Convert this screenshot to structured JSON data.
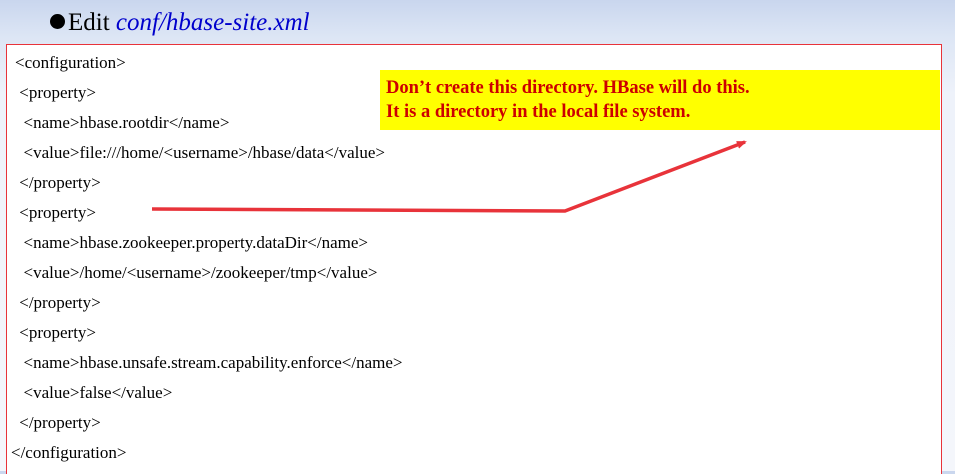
{
  "heading": {
    "prefix": "Edit ",
    "filename": "conf/hbase-site.xml"
  },
  "code_lines": [
    "<configuration>",
    " <property>",
    "  <name>hbase.rootdir</name>",
    "  <value>file:///home/<username>/hbase/data</value>",
    " </property>",
    " <property>",
    "  <name>hbase.zookeeper.property.dataDir</name>",
    "  <value>/home/<username>/zookeeper/tmp</value>",
    " </property>",
    " <property>",
    "  <name>hbase.unsafe.stream.capability.enforce</name>",
    "  <value>false</value>",
    " </property>",
    "</configuration>"
  ],
  "note": {
    "line1": "Don’t create this directory. HBase will do this.",
    "line2": "It is a directory in the local file system."
  },
  "colors": {
    "box_border": "#e8333a",
    "note_background": "#ffff00",
    "note_text": "#cc0000",
    "arrow": "#e8333a",
    "filename": "#0000cc"
  }
}
